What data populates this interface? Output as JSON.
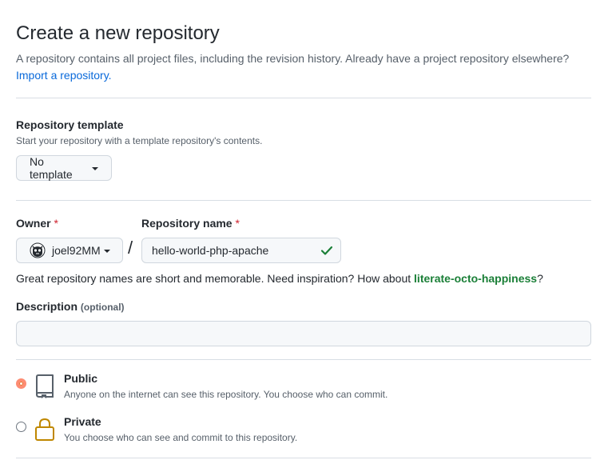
{
  "header": {
    "title": "Create a new repository",
    "description": "A repository contains all project files, including the revision history. Already have a project repository elsewhere?",
    "import_link": "Import a repository."
  },
  "template": {
    "label": "Repository template",
    "note": "Start your repository with a template repository's contents.",
    "button_label": "No template"
  },
  "owner": {
    "label": "Owner",
    "required_mark": "*",
    "value": "joel92MM",
    "avatar_icon": "octocat-avatar-icon"
  },
  "repo_name": {
    "label": "Repository name",
    "required_mark": "*",
    "value": "hello-world-php-apache",
    "separator": "/",
    "valid_icon": "check-icon"
  },
  "hint": {
    "text": "Great repository names are short and memorable. Need inspiration? How about ",
    "suggestion": "literate-octo-happiness",
    "suffix": "?"
  },
  "description": {
    "label": "Description",
    "optional": "(optional)",
    "value": ""
  },
  "visibility": {
    "options": [
      {
        "title": "Public",
        "description": "Anyone on the internet can see this repository. You choose who can commit.",
        "selected": true,
        "icon": "repo-icon"
      },
      {
        "title": "Private",
        "description": "You choose who can see and commit to this repository.",
        "selected": false,
        "icon": "lock-icon"
      }
    ]
  },
  "colors": {
    "link": "#0969da",
    "suggestion": "#1a7f37",
    "required": "#cf222e",
    "radio_selected": "#e16f24",
    "lock_icon": "#bf8700"
  }
}
